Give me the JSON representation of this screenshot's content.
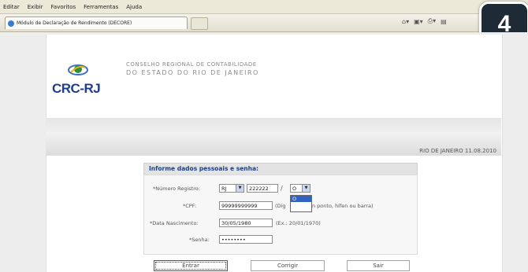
{
  "menu": [
    "Editar",
    "Exibir",
    "Favoritos",
    "Ferramentas",
    "Ajuda"
  ],
  "tab": {
    "title": "Módulo de Declaração de Rendimento (DECORE)"
  },
  "step_badge": "4",
  "header": {
    "logo_text": "CRC-RJ",
    "org_line1": "CONSELHO REGIONAL DE CONTABILIDADE",
    "org_line2": "DO ESTADO DO RIO DE JANEIRO",
    "date": "RIO DE JANEIRO 11.08.2010"
  },
  "form": {
    "title": "Informe dados pessoais e senha:",
    "registro_label": "*Número Registro:",
    "registro_uf": "RJ",
    "registro_num": "222222",
    "separator": "/",
    "registro_dv": "O",
    "dropdown_option": "O",
    "cpf_label": "*CPF:",
    "cpf_value": "99999999999",
    "cpf_dig": "(Dig",
    "cpf_hint": "n ponto, hífen ou barra)",
    "nasc_label": "*Data Nascimento:",
    "nasc_value": "30/05/1980",
    "nasc_hint": "(Ex.: 20/01/1970)",
    "senha_label": "*Senha:",
    "senha_value": "••••••••"
  },
  "buttons": {
    "enter": "Entrar",
    "clear": "Corrigir",
    "exit": "Sair"
  },
  "colors": {
    "brand": "#1d3d8f",
    "selected": "#3163c5",
    "badge": "#1e2a36"
  }
}
